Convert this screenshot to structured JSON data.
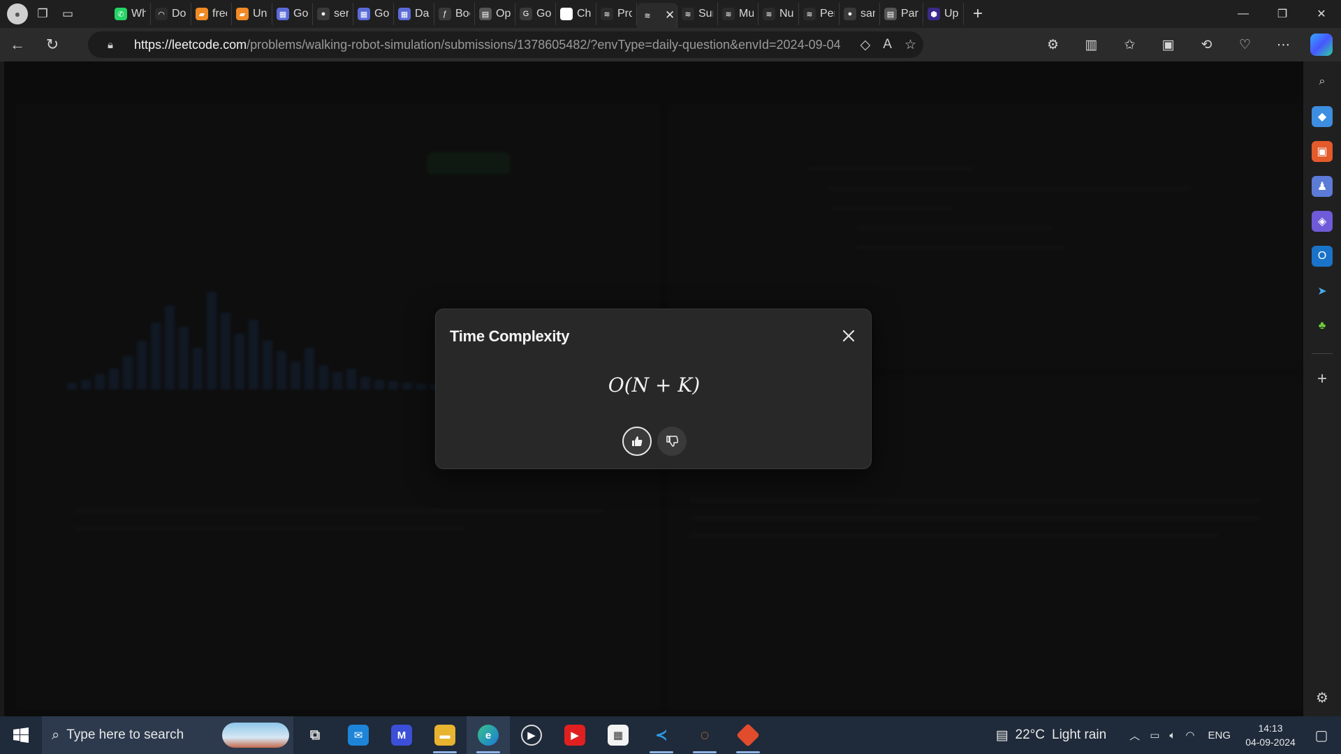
{
  "browser": {
    "tabs": [
      {
        "title": "Wha",
        "icon": "whatsapp-icon",
        "color": "#25d366"
      },
      {
        "title": "Doc",
        "icon": "loading-icon",
        "color": "#2b2b2b"
      },
      {
        "title": "free",
        "icon": "book-icon",
        "color": "#f08a24"
      },
      {
        "title": "Unti",
        "icon": "book-icon",
        "color": "#f08a24"
      },
      {
        "title": "Goo",
        "icon": "grid-icon",
        "color": "#5a6bd8"
      },
      {
        "title": "serp",
        "icon": "github-icon",
        "color": "#3a3a3a"
      },
      {
        "title": "Goo",
        "icon": "grid-icon",
        "color": "#5a6bd8"
      },
      {
        "title": "Dash",
        "icon": "grid-icon",
        "color": "#5a6bd8"
      },
      {
        "title": "Bool",
        "icon": "formula-icon",
        "color": "#3a3a3a"
      },
      {
        "title": "Ope",
        "icon": "document-icon",
        "color": "#555555"
      },
      {
        "title": "Goo",
        "icon": "google-icon",
        "color": "#3a3a3a"
      },
      {
        "title": "Chat",
        "icon": "openai-icon",
        "color": "#ffffff"
      },
      {
        "title": "Prob",
        "icon": "leetcode-icon",
        "color": "#2b2b2b"
      },
      {
        "title": "",
        "icon": "leetcode-icon",
        "color": "#2b2b2b",
        "active": true
      },
      {
        "title": "Sum",
        "icon": "leetcode-icon",
        "color": "#2b2b2b"
      },
      {
        "title": "Mul",
        "icon": "leetcode-icon",
        "color": "#2b2b2b"
      },
      {
        "title": "Nun",
        "icon": "leetcode-icon",
        "color": "#2b2b2b"
      },
      {
        "title": "Perr",
        "icon": "leetcode-icon",
        "color": "#2b2b2b"
      },
      {
        "title": "sam",
        "icon": "github-icon",
        "color": "#3a3a3a"
      },
      {
        "title": "Paris",
        "icon": "document-icon",
        "color": "#555555"
      },
      {
        "title": "Upg",
        "icon": "hexagon-icon",
        "color": "#3b2a8a"
      }
    ],
    "url_host": "https://leetcode.com",
    "url_path": "/problems/walking-robot-simulation/submissions/1378605482/?envType=daily-question&envId=2024-09-04"
  },
  "modal": {
    "title": "Time Complexity",
    "formula": "O(N + K)"
  },
  "taskbar": {
    "search_placeholder": "Type here to search",
    "weather_temp": "22°C",
    "weather_desc": "Light rain",
    "language": "ENG",
    "time": "14:13",
    "date": "04-09-2024"
  }
}
